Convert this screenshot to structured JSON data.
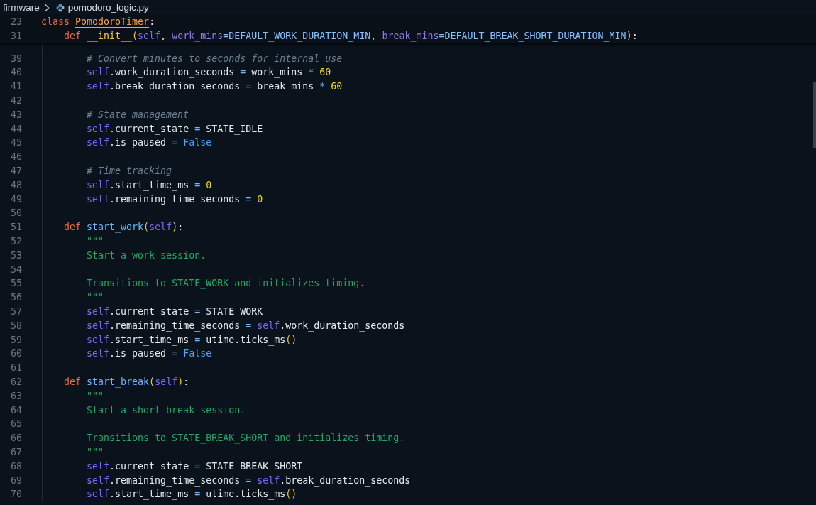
{
  "breadcrumb": {
    "folder": "firmware",
    "file": "pomodoro_logic.py"
  },
  "sticky_lines": [
    {
      "number": "23",
      "tokens": [
        {
          "kind": "kw",
          "text": "class "
        },
        {
          "kind": "cls",
          "text": "PomodoroTimer"
        },
        {
          "kind": "plain",
          "text": ":"
        }
      ],
      "children": [
        {
          "number": "31",
          "tokens": [
            {
              "kind": "kw",
              "text": "def "
            },
            {
              "kind": "magic",
              "text": "__init__"
            },
            {
              "kind": "paren",
              "text": "("
            },
            {
              "kind": "self",
              "text": "self"
            },
            {
              "kind": "plain",
              "text": ", "
            },
            {
              "kind": "param",
              "text": "work_mins"
            },
            {
              "kind": "const",
              "text": "=DEFAULT_WORK_DURATION_MIN"
            },
            {
              "kind": "plain",
              "text": ", "
            },
            {
              "kind": "param",
              "text": "break_mins"
            },
            {
              "kind": "const",
              "text": "=DEFAULT_BREAK_SHORT_DURATION_MIN"
            },
            {
              "kind": "paren",
              "text": ")"
            },
            {
              "kind": "plain",
              "text": ":"
            }
          ]
        }
      ]
    }
  ],
  "lines": [
    {
      "children": [
        {
          "number": "39",
          "tokens": [
            {
              "kind": "comment",
              "text": "# Convert minutes to seconds for internal use"
            }
          ]
        },
        {
          "number": "40",
          "tokens": [
            {
              "kind": "self",
              "text": "self"
            },
            {
              "kind": "plain",
              "text": ".work_duration_seconds"
            },
            {
              "kind": "op",
              "text": " = "
            },
            {
              "kind": "plain",
              "text": "work_mins"
            },
            {
              "kind": "op",
              "text": " * "
            },
            {
              "kind": "num",
              "text": "60"
            }
          ]
        },
        {
          "number": "41",
          "tokens": [
            {
              "kind": "self",
              "text": "self"
            },
            {
              "kind": "plain",
              "text": ".break_duration_seconds"
            },
            {
              "kind": "op",
              "text": " = "
            },
            {
              "kind": "plain",
              "text": "break_mins"
            },
            {
              "kind": "op",
              "text": " * "
            },
            {
              "kind": "num",
              "text": "60"
            }
          ]
        },
        {
          "number": "42"
        },
        {
          "number": "43",
          "tokens": [
            {
              "kind": "comment",
              "text": "# State management"
            }
          ]
        },
        {
          "number": "44",
          "tokens": [
            {
              "kind": "self",
              "text": "self"
            },
            {
              "kind": "plain",
              "text": ".current_state"
            },
            {
              "kind": "op",
              "text": " = "
            },
            {
              "kind": "plain",
              "text": "STATE_IDLE"
            }
          ]
        },
        {
          "number": "45",
          "tokens": [
            {
              "kind": "self",
              "text": "self"
            },
            {
              "kind": "plain",
              "text": ".is_paused"
            },
            {
              "kind": "op",
              "text": " = "
            },
            {
              "kind": "bool",
              "text": "False"
            }
          ]
        },
        {
          "number": "46"
        },
        {
          "number": "47",
          "tokens": [
            {
              "kind": "comment",
              "text": "# Time tracking"
            }
          ]
        },
        {
          "number": "48",
          "tokens": [
            {
              "kind": "self",
              "text": "self"
            },
            {
              "kind": "plain",
              "text": ".start_time_ms"
            },
            {
              "kind": "op",
              "text": " = "
            },
            {
              "kind": "num",
              "text": "0"
            }
          ]
        },
        {
          "number": "49",
          "tokens": [
            {
              "kind": "self",
              "text": "self"
            },
            {
              "kind": "plain",
              "text": ".remaining_time_seconds"
            },
            {
              "kind": "op",
              "text": " = "
            },
            {
              "kind": "num",
              "text": "0"
            }
          ]
        },
        {
          "number": "50"
        }
      ]
    },
    {
      "number": "51",
      "tokens": [
        {
          "kind": "kw",
          "text": "def "
        },
        {
          "kind": "fn",
          "text": "start_work"
        },
        {
          "kind": "paren",
          "text": "("
        },
        {
          "kind": "self",
          "text": "self"
        },
        {
          "kind": "paren",
          "text": ")"
        },
        {
          "kind": "plain",
          "text": ":"
        }
      ],
      "children": [
        {
          "number": "52",
          "tokens": [
            {
              "kind": "str",
              "text": "\"\"\""
            }
          ]
        },
        {
          "number": "53",
          "tokens": [
            {
              "kind": "str",
              "text": "Start a work session."
            }
          ]
        },
        {
          "number": "54"
        },
        {
          "number": "55",
          "tokens": [
            {
              "kind": "str",
              "text": "Transitions to STATE_WORK and initializes timing."
            }
          ]
        },
        {
          "number": "56",
          "tokens": [
            {
              "kind": "str",
              "text": "\"\"\""
            }
          ]
        },
        {
          "number": "57",
          "tokens": [
            {
              "kind": "self",
              "text": "self"
            },
            {
              "kind": "plain",
              "text": ".current_state"
            },
            {
              "kind": "op",
              "text": " = "
            },
            {
              "kind": "plain",
              "text": "STATE_WORK"
            }
          ]
        },
        {
          "number": "58",
          "tokens": [
            {
              "kind": "self",
              "text": "self"
            },
            {
              "kind": "plain",
              "text": ".remaining_time_seconds"
            },
            {
              "kind": "op",
              "text": " = "
            },
            {
              "kind": "self",
              "text": "self"
            },
            {
              "kind": "plain",
              "text": ".work_duration_seconds"
            }
          ]
        },
        {
          "number": "59",
          "tokens": [
            {
              "kind": "self",
              "text": "self"
            },
            {
              "kind": "plain",
              "text": ".start_time_ms"
            },
            {
              "kind": "op",
              "text": " = "
            },
            {
              "kind": "plain",
              "text": "utime.ticks_ms"
            },
            {
              "kind": "paren",
              "text": "()"
            }
          ]
        },
        {
          "number": "60",
          "tokens": [
            {
              "kind": "self",
              "text": "self"
            },
            {
              "kind": "plain",
              "text": ".is_paused"
            },
            {
              "kind": "op",
              "text": " = "
            },
            {
              "kind": "bool",
              "text": "False"
            }
          ]
        },
        {
          "number": "61"
        }
      ]
    },
    {
      "number": "62",
      "tokens": [
        {
          "kind": "kw",
          "text": "def "
        },
        {
          "kind": "fn",
          "text": "start_break"
        },
        {
          "kind": "paren",
          "text": "("
        },
        {
          "kind": "self",
          "text": "self"
        },
        {
          "kind": "paren",
          "text": ")"
        },
        {
          "kind": "plain",
          "text": ":"
        }
      ],
      "children": [
        {
          "number": "63",
          "tokens": [
            {
              "kind": "str",
              "text": "\"\"\""
            }
          ]
        },
        {
          "number": "64",
          "tokens": [
            {
              "kind": "str",
              "text": "Start a short break session."
            }
          ]
        },
        {
          "number": "65"
        },
        {
          "number": "66",
          "tokens": [
            {
              "kind": "str",
              "text": "Transitions to STATE_BREAK_SHORT and initializes timing."
            }
          ]
        },
        {
          "number": "67",
          "tokens": [
            {
              "kind": "str",
              "text": "\"\"\""
            }
          ]
        },
        {
          "number": "68",
          "tokens": [
            {
              "kind": "self",
              "text": "self"
            },
            {
              "kind": "plain",
              "text": ".current_state"
            },
            {
              "kind": "op",
              "text": " = "
            },
            {
              "kind": "plain",
              "text": "STATE_BREAK_SHORT"
            }
          ]
        },
        {
          "number": "69",
          "tokens": [
            {
              "kind": "self",
              "text": "self"
            },
            {
              "kind": "plain",
              "text": ".remaining_time_seconds"
            },
            {
              "kind": "op",
              "text": " = "
            },
            {
              "kind": "self",
              "text": "self"
            },
            {
              "kind": "plain",
              "text": ".break_duration_seconds"
            }
          ]
        },
        {
          "number": "70",
          "tokens": [
            {
              "kind": "self",
              "text": "self"
            },
            {
              "kind": "plain",
              "text": ".start_time_ms"
            },
            {
              "kind": "op",
              "text": " = "
            },
            {
              "kind": "plain",
              "text": "utime.ticks_ms"
            },
            {
              "kind": "paren",
              "text": "()"
            }
          ]
        }
      ]
    }
  ]
}
